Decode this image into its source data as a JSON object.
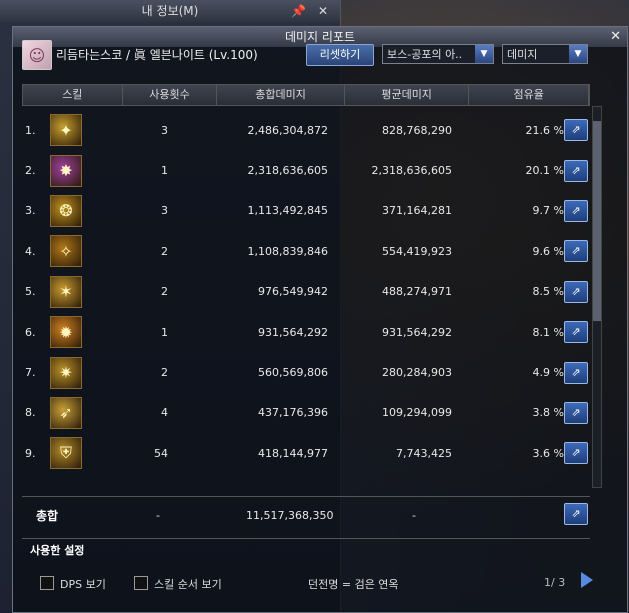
{
  "background_window": {
    "title": "내 정보(M)",
    "pin_icon": "pin-icon",
    "close_icon": "close-icon"
  },
  "report": {
    "title": "데미지 리포트",
    "close_label": "✕",
    "character_name": "리듬타는스코 / 眞 엘븐나이트 (Lv.100)",
    "reset_button": "리셋하기",
    "target_dropdown": "보스-공포의 아..",
    "mode_dropdown": "데미지",
    "columns": [
      "스킬",
      "사용횟수",
      "총합데미지",
      "평균데미지",
      "점유율"
    ],
    "rows": [
      {
        "rank": "1.",
        "count": "3",
        "total": "2,486,304,872",
        "avg": "828,768,290",
        "share": "21.6 %",
        "icon_color": "#c8a030"
      },
      {
        "rank": "2.",
        "count": "1",
        "total": "2,318,636,605",
        "avg": "2,318,636,605",
        "share": "20.1 %",
        "icon_color": "#a040a0"
      },
      {
        "rank": "3.",
        "count": "3",
        "total": "1,113,492,845",
        "avg": "371,164,281",
        "share": "9.7 %",
        "icon_color": "#c09020"
      },
      {
        "rank": "4.",
        "count": "2",
        "total": "1,108,839,846",
        "avg": "554,419,923",
        "share": "9.6 %",
        "icon_color": "#b07818"
      },
      {
        "rank": "5.",
        "count": "2",
        "total": "976,549,942",
        "avg": "488,274,971",
        "share": "8.5 %",
        "icon_color": "#c89a30"
      },
      {
        "rank": "6.",
        "count": "1",
        "total": "931,564,292",
        "avg": "931,564,292",
        "share": "8.1 %",
        "icon_color": "#d08020"
      },
      {
        "rank": "7.",
        "count": "2",
        "total": "560,569,806",
        "avg": "280,284,903",
        "share": "4.9 %",
        "icon_color": "#b89028"
      },
      {
        "rank": "8.",
        "count": "4",
        "total": "437,176,396",
        "avg": "109,294,099",
        "share": "3.8 %",
        "icon_color": "#c8a038"
      },
      {
        "rank": "9.",
        "count": "54",
        "total": "418,144,977",
        "avg": "7,743,425",
        "share": "3.6 %",
        "icon_color": "#b08a28"
      }
    ],
    "total": {
      "label": "총합",
      "count": "-",
      "total": "11,517,368,350",
      "avg": "-"
    },
    "settings_label": "사용한 설정",
    "dps_checkbox_label": "DPS 보기",
    "skill_order_checkbox_label": "스킬 순서 보기",
    "dungeon_label": "던전명 = 검은 연옥",
    "page_indicator": "1/ 3"
  },
  "colors": {
    "accent": "#3d6ab8",
    "window_bg": "#0a0e16"
  }
}
